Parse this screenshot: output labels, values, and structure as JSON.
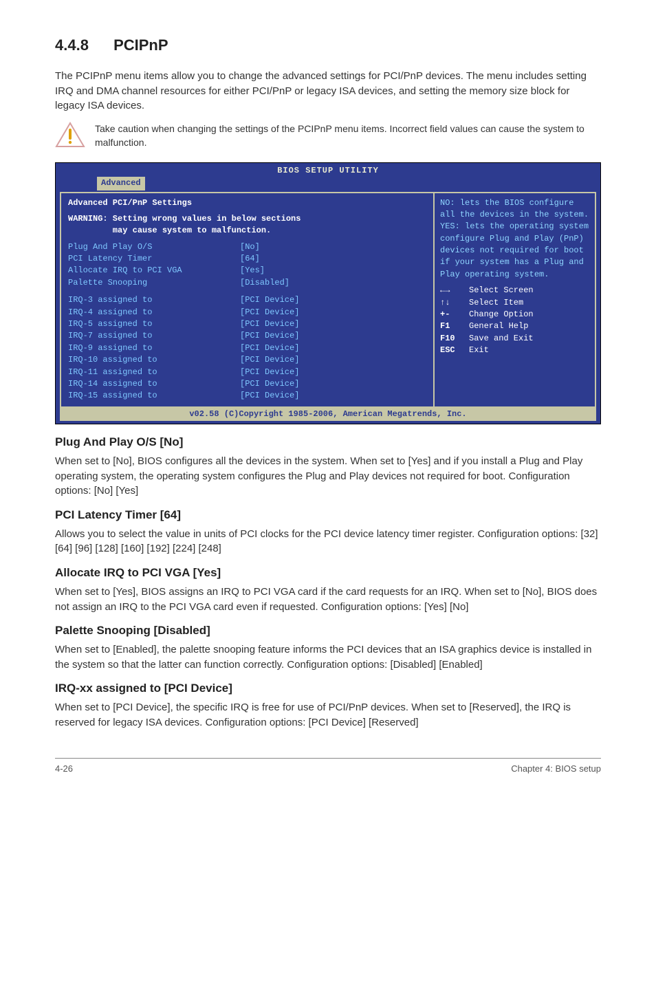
{
  "section": {
    "number": "4.4.8",
    "title": "PCIPnP",
    "intro": "The PCIPnP menu items allow you to change the advanced settings for PCI/PnP devices. The menu includes setting IRQ and DMA channel resources for either PCI/PnP or legacy ISA devices, and setting the memory size block for legacy ISA devices.",
    "caution": "Take caution when changing the settings of the PCIPnP menu items. Incorrect field values can cause the system to malfunction."
  },
  "bios": {
    "title": "BIOS SETUP UTILITY",
    "tab": "Advanced",
    "heading": "Advanced PCI/PnP Settings",
    "warning_line1": "WARNING: Setting wrong values in below sections",
    "warning_line2": "         may cause system to malfunction.",
    "settings_top": [
      {
        "label": "Plug And Play O/S",
        "value": "[No]"
      },
      {
        "label": "PCI Latency Timer",
        "value": "[64]"
      },
      {
        "label": "Allocate IRQ to PCI VGA",
        "value": "[Yes]"
      },
      {
        "label": "Palette Snooping",
        "value": "[Disabled]"
      }
    ],
    "settings_irq": [
      {
        "label": "IRQ-3 assigned to",
        "value": "[PCI Device]"
      },
      {
        "label": "IRQ-4 assigned to",
        "value": "[PCI Device]"
      },
      {
        "label": "IRQ-5 assigned to",
        "value": "[PCI Device]"
      },
      {
        "label": "IRQ-7 assigned to",
        "value": "[PCI Device]"
      },
      {
        "label": "IRQ-9 assigned to",
        "value": "[PCI Device]"
      },
      {
        "label": "IRQ-10 assigned to",
        "value": "[PCI Device]"
      },
      {
        "label": "IRQ-11 assigned to",
        "value": "[PCI Device]"
      },
      {
        "label": "IRQ-14 assigned to",
        "value": "[PCI Device]"
      },
      {
        "label": "IRQ-15 assigned to",
        "value": "[PCI Device]"
      }
    ],
    "help_text": "NO: lets the BIOS configure all the devices in the system.\nYES: lets the operating system configure Plug and Play (PnP) devices not required for boot if your system has a Plug and Play operating system.",
    "keys": [
      {
        "k": "←→",
        "t": "Select Screen"
      },
      {
        "k": "↑↓",
        "t": "Select Item"
      },
      {
        "k": "+-",
        "t": "Change Option"
      },
      {
        "k": "F1",
        "t": "General Help"
      },
      {
        "k": "F10",
        "t": "Save and Exit"
      },
      {
        "k": "ESC",
        "t": "Exit"
      }
    ],
    "footer": "v02.58 (C)Copyright 1985-2006, American Megatrends, Inc."
  },
  "subsections": [
    {
      "title": "Plug And Play O/S [No]",
      "body": "When set to [No], BIOS configures all the devices in the system. When set to [Yes] and if you install a Plug and Play operating system, the operating system configures the Plug and Play devices not required for boot. Configuration options: [No] [Yes]"
    },
    {
      "title": "PCI Latency Timer [64]",
      "body": "Allows you to select the value in units of PCI clocks for the PCI device latency timer register. Configuration options: [32] [64] [96] [128] [160] [192] [224] [248]"
    },
    {
      "title": "Allocate IRQ to PCI VGA [Yes]",
      "body": "When set to [Yes], BIOS assigns an IRQ to PCI VGA card if the card requests for an IRQ. When set to [No], BIOS does not assign an IRQ to the PCI VGA card even if requested. Configuration options: [Yes] [No]"
    },
    {
      "title": "Palette Snooping [Disabled]",
      "body": "When set to [Enabled], the palette snooping feature informs the PCI devices that an ISA graphics device is installed in the system so that the latter can function correctly. Configuration options: [Disabled] [Enabled]"
    },
    {
      "title": "IRQ-xx assigned to [PCI Device]",
      "body": "When set to [PCI Device], the specific IRQ is free for use of PCI/PnP devices. When set to [Reserved], the IRQ is reserved for legacy ISA devices. Configuration options: [PCI Device] [Reserved]"
    }
  ],
  "footer": {
    "left": "4-26",
    "right": "Chapter 4: BIOS setup"
  }
}
